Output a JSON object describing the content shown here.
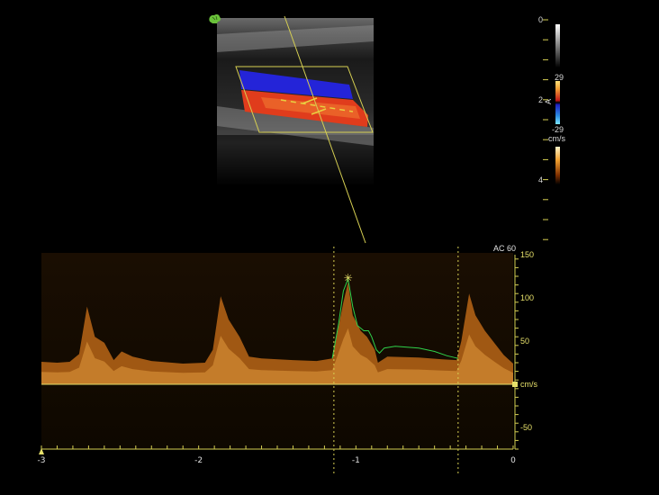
{
  "colors": {
    "background": "#000000",
    "graticule": "#d6cf52",
    "envelope": "#2fd14a",
    "spectrum": "#d27a1e",
    "flow_toward": "#e03a1e",
    "flow_away": "#2a2ae0"
  },
  "icons": {
    "probe_marker": "brain-icon"
  },
  "labels": {
    "acoustic_setting": "AC 60",
    "velocity_unit": "cm/s",
    "color_bar_unit": "cm/s",
    "color_bar_top": "29",
    "color_bar_bottom": "-29",
    "color_bar_mark": "A"
  },
  "depth_scale": {
    "ticks": [
      {
        "label": "0"
      },
      {
        "label": "2"
      },
      {
        "label": "4"
      }
    ]
  },
  "doppler": {
    "velocity_ticks": [
      {
        "value": 150,
        "label": "150"
      },
      {
        "value": 100,
        "label": "100"
      },
      {
        "value": 50,
        "label": "50"
      },
      {
        "value": 0,
        "label": "cm/s"
      },
      {
        "value": -50,
        "label": "-50"
      }
    ],
    "time_ticks": [
      {
        "value": -3,
        "label": "-3"
      },
      {
        "value": -2,
        "label": "-2"
      },
      {
        "value": -1,
        "label": "-1"
      },
      {
        "value": 0,
        "label": "0"
      }
    ]
  },
  "chart_data": {
    "type": "line",
    "xlim": [
      -3,
      0
    ],
    "ylim": [
      -75,
      150
    ],
    "baseline": 0,
    "cycle_markers": [
      -1.14,
      -0.35
    ],
    "peak_marker": {
      "x": -1.05,
      "y": 122
    },
    "spectrum": [
      [
        -3.0,
        26
      ],
      [
        -2.9,
        25
      ],
      [
        -2.82,
        26
      ],
      [
        -2.76,
        35
      ],
      [
        -2.71,
        90
      ],
      [
        -2.66,
        55
      ],
      [
        -2.6,
        48
      ],
      [
        -2.54,
        28
      ],
      [
        -2.49,
        38
      ],
      [
        -2.42,
        32
      ],
      [
        -2.3,
        27
      ],
      [
        -2.1,
        24
      ],
      [
        -1.96,
        25
      ],
      [
        -1.91,
        40
      ],
      [
        -1.86,
        102
      ],
      [
        -1.81,
        75
      ],
      [
        -1.74,
        55
      ],
      [
        -1.68,
        32
      ],
      [
        -1.6,
        30
      ],
      [
        -1.4,
        28
      ],
      [
        -1.25,
        27
      ],
      [
        -1.15,
        30
      ],
      [
        -1.08,
        95
      ],
      [
        -1.05,
        118
      ],
      [
        -1.02,
        80
      ],
      [
        -0.97,
        62
      ],
      [
        -0.93,
        55
      ],
      [
        -0.88,
        40
      ],
      [
        -0.86,
        25
      ],
      [
        -0.8,
        32
      ],
      [
        -0.6,
        31
      ],
      [
        -0.45,
        29
      ],
      [
        -0.36,
        28
      ],
      [
        -0.33,
        50
      ],
      [
        -0.28,
        105
      ],
      [
        -0.24,
        80
      ],
      [
        -0.18,
        62
      ],
      [
        -0.12,
        48
      ],
      [
        -0.06,
        34
      ],
      [
        0.0,
        24
      ]
    ],
    "envelope": [
      [
        -1.15,
        30
      ],
      [
        -1.11,
        70
      ],
      [
        -1.08,
        108
      ],
      [
        -1.05,
        122
      ],
      [
        -1.02,
        90
      ],
      [
        -0.99,
        68
      ],
      [
        -0.95,
        62
      ],
      [
        -0.92,
        62
      ],
      [
        -0.9,
        55
      ],
      [
        -0.87,
        40
      ],
      [
        -0.85,
        36
      ],
      [
        -0.82,
        42
      ],
      [
        -0.75,
        44
      ],
      [
        -0.6,
        42
      ],
      [
        -0.5,
        38
      ],
      [
        -0.42,
        33
      ],
      [
        -0.35,
        30
      ]
    ]
  }
}
